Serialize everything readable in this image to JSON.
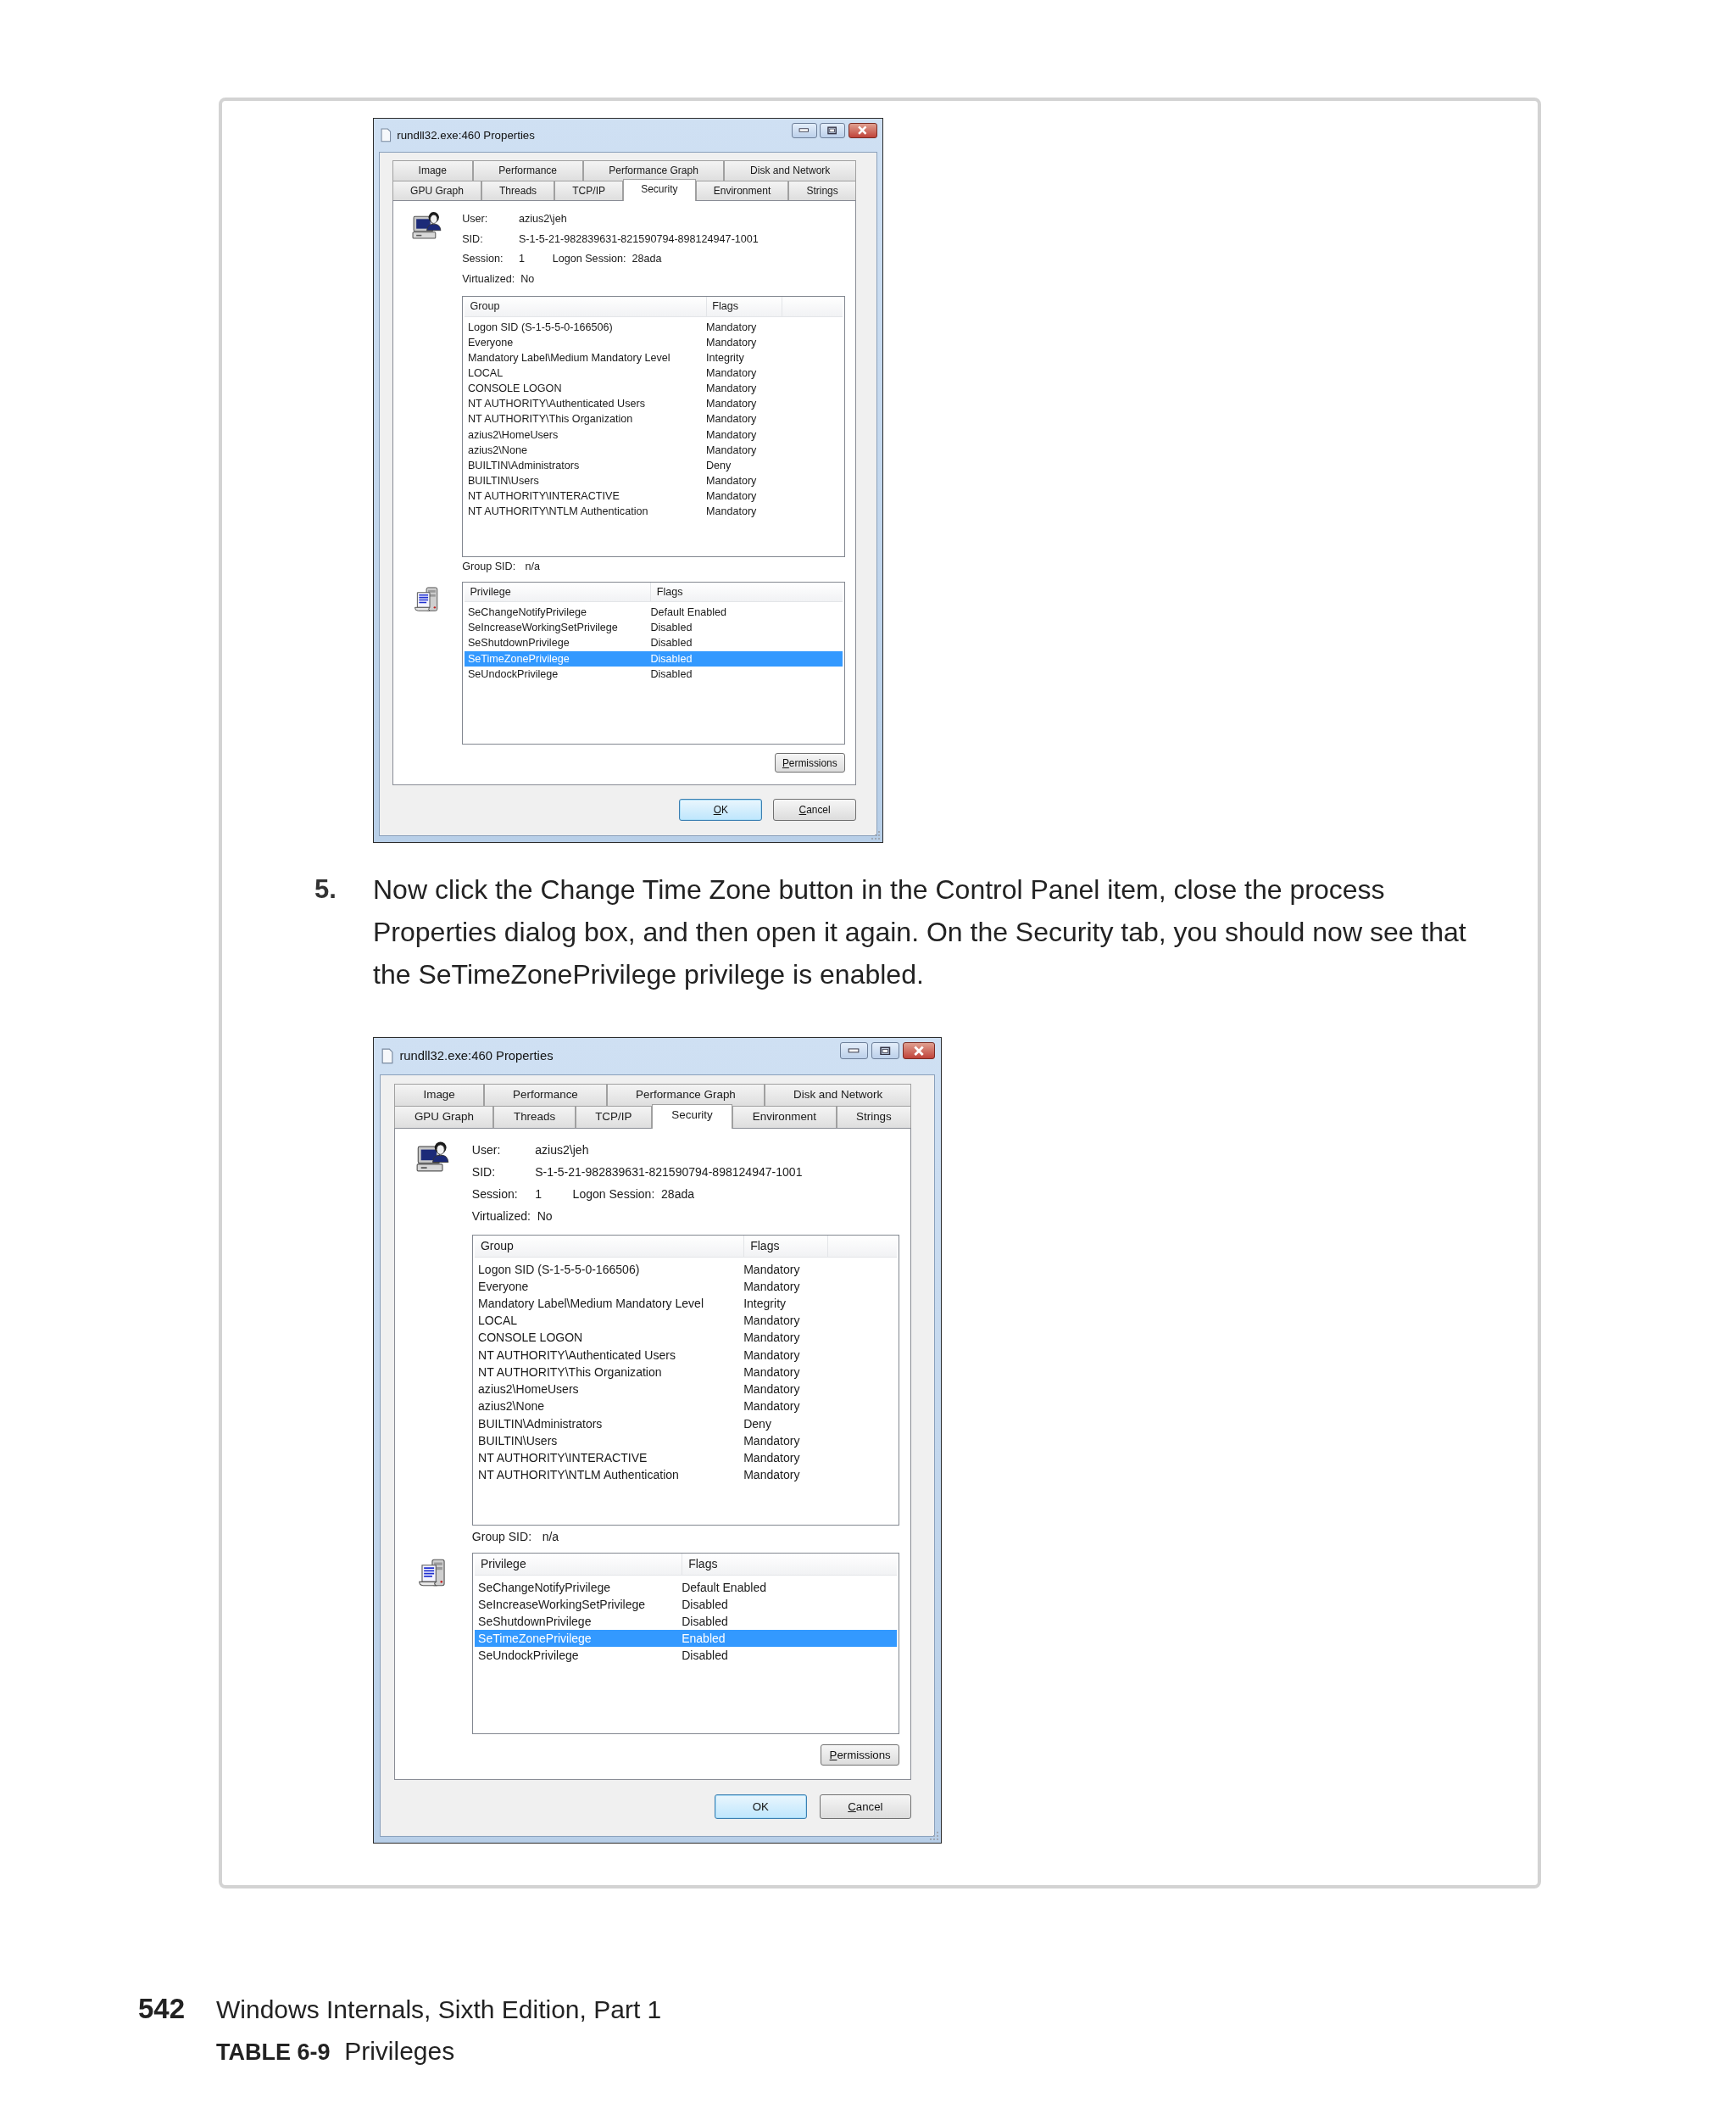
{
  "content": [
    {
      "kind": "dialog",
      "title": "rundll32.exe:460 Properties",
      "tab_rows": [
        [
          {
            "label": "Image",
            "selected": false
          },
          {
            "label": "Performance",
            "selected": false
          },
          {
            "label": "Performance Graph",
            "selected": false
          },
          {
            "label": "Disk and Network",
            "selected": false
          }
        ],
        [
          {
            "label": "GPU Graph",
            "selected": false
          },
          {
            "label": "Threads",
            "selected": false
          },
          {
            "label": "TCP/IP",
            "selected": false
          },
          {
            "label": "Security",
            "selected": true
          },
          {
            "label": "Environment",
            "selected": false
          },
          {
            "label": "Strings",
            "selected": false
          }
        ]
      ],
      "info_lines": [
        [
          {
            "label": "User:",
            "value": "azius2\\jeh"
          }
        ],
        [
          {
            "label": "SID:",
            "value": "S-1-5-21-982839631-821590794-898124947-1001"
          }
        ],
        [
          {
            "label": "Session:",
            "value": "1"
          },
          {
            "label": "Logon Session:",
            "value": "28ada"
          }
        ],
        [
          {
            "label": "Virtualized:",
            "value": "No"
          }
        ]
      ],
      "groups": {
        "columns": [
          "Group",
          "Flags"
        ],
        "rows": [
          {
            "group": "Logon SID (S-1-5-5-0-166506)",
            "flags": "Mandatory"
          },
          {
            "group": "Everyone",
            "flags": "Mandatory"
          },
          {
            "group": "Mandatory Label\\Medium Mandatory Level",
            "flags": "Integrity"
          },
          {
            "group": "LOCAL",
            "flags": "Mandatory"
          },
          {
            "group": "CONSOLE LOGON",
            "flags": "Mandatory"
          },
          {
            "group": "NT AUTHORITY\\Authenticated Users",
            "flags": "Mandatory"
          },
          {
            "group": "NT AUTHORITY\\This Organization",
            "flags": "Mandatory"
          },
          {
            "group": "azius2\\HomeUsers",
            "flags": "Mandatory"
          },
          {
            "group": "azius2\\None",
            "flags": "Mandatory"
          },
          {
            "group": "BUILTIN\\Administrators",
            "flags": "Deny"
          },
          {
            "group": "BUILTIN\\Users",
            "flags": "Mandatory"
          },
          {
            "group": "NT AUTHORITY\\INTERACTIVE",
            "flags": "Mandatory"
          },
          {
            "group": "NT AUTHORITY\\NTLM Authentication",
            "flags": "Mandatory"
          }
        ]
      },
      "group_sid": {
        "label": "Group SID:",
        "value": "n/a"
      },
      "privileges": {
        "columns": [
          "Privilege",
          "Flags"
        ],
        "rows": [
          {
            "privilege": "SeChangeNotifyPrivilege",
            "flags": "Default Enabled",
            "selected": false
          },
          {
            "privilege": "SeIncreaseWorkingSetPrivilege",
            "flags": "Disabled",
            "selected": false
          },
          {
            "privilege": "SeShutdownPrivilege",
            "flags": "Disabled",
            "selected": false
          },
          {
            "privilege": "SeTimeZonePrivilege",
            "flags": "Disabled",
            "selected": true
          },
          {
            "privilege": "SeUndockPrivilege",
            "flags": "Disabled",
            "selected": false
          }
        ]
      },
      "permissions_button": {
        "label": "Permissions",
        "access_key_shown": true
      },
      "buttons": [
        {
          "label": "OK",
          "default": true,
          "access_key_shown": true
        },
        {
          "label": "Cancel",
          "default": false,
          "access_key_shown": true
        }
      ]
    },
    {
      "kind": "step",
      "number": "5.",
      "text": "Now click the Change Time Zone button in the Control Panel item, close the process Properties dialog box, and then open it again. On the Security tab, you should now see that the SeTimeZonePrivilege privilege is enabled."
    },
    {
      "kind": "dialog",
      "title": "rundll32.exe:460 Properties",
      "tab_rows": [
        [
          {
            "label": "Image",
            "selected": false
          },
          {
            "label": "Performance",
            "selected": false
          },
          {
            "label": "Performance Graph",
            "selected": false
          },
          {
            "label": "Disk and Network",
            "selected": false
          }
        ],
        [
          {
            "label": "GPU Graph",
            "selected": false
          },
          {
            "label": "Threads",
            "selected": false
          },
          {
            "label": "TCP/IP",
            "selected": false
          },
          {
            "label": "Security",
            "selected": true
          },
          {
            "label": "Environment",
            "selected": false
          },
          {
            "label": "Strings",
            "selected": false
          }
        ]
      ],
      "info_lines": [
        [
          {
            "label": "User:",
            "value": "azius2\\jeh"
          }
        ],
        [
          {
            "label": "SID:",
            "value": "S-1-5-21-982839631-821590794-898124947-1001"
          }
        ],
        [
          {
            "label": "Session:",
            "value": "1"
          },
          {
            "label": "Logon Session:",
            "value": "28ada"
          }
        ],
        [
          {
            "label": "Virtualized:",
            "value": "No"
          }
        ]
      ],
      "groups": {
        "columns": [
          "Group",
          "Flags"
        ],
        "rows": [
          {
            "group": "Logon SID (S-1-5-5-0-166506)",
            "flags": "Mandatory"
          },
          {
            "group": "Everyone",
            "flags": "Mandatory"
          },
          {
            "group": "Mandatory Label\\Medium Mandatory Level",
            "flags": "Integrity"
          },
          {
            "group": "LOCAL",
            "flags": "Mandatory"
          },
          {
            "group": "CONSOLE LOGON",
            "flags": "Mandatory"
          },
          {
            "group": "NT AUTHORITY\\Authenticated Users",
            "flags": "Mandatory"
          },
          {
            "group": "NT AUTHORITY\\This Organization",
            "flags": "Mandatory"
          },
          {
            "group": "azius2\\HomeUsers",
            "flags": "Mandatory"
          },
          {
            "group": "azius2\\None",
            "flags": "Mandatory"
          },
          {
            "group": "BUILTIN\\Administrators",
            "flags": "Deny"
          },
          {
            "group": "BUILTIN\\Users",
            "flags": "Mandatory"
          },
          {
            "group": "NT AUTHORITY\\INTERACTIVE",
            "flags": "Mandatory"
          },
          {
            "group": "NT AUTHORITY\\NTLM Authentication",
            "flags": "Mandatory"
          }
        ]
      },
      "group_sid": {
        "label": "Group SID:",
        "value": "n/a"
      },
      "privileges": {
        "columns": [
          "Privilege",
          "Flags"
        ],
        "rows": [
          {
            "privilege": "SeChangeNotifyPrivilege",
            "flags": "Default Enabled",
            "selected": false
          },
          {
            "privilege": "SeIncreaseWorkingSetPrivilege",
            "flags": "Disabled",
            "selected": false
          },
          {
            "privilege": "SeShutdownPrivilege",
            "flags": "Disabled",
            "selected": false
          },
          {
            "privilege": "SeTimeZonePrivilege",
            "flags": "Enabled",
            "selected": true
          },
          {
            "privilege": "SeUndockPrivilege",
            "flags": "Disabled",
            "selected": false
          }
        ]
      },
      "permissions_button": {
        "label": "Permissions",
        "access_key_shown": true
      },
      "buttons": [
        {
          "label": "OK",
          "default": true,
          "access_key_shown": false
        },
        {
          "label": "Cancel",
          "default": false,
          "access_key_shown": true
        }
      ]
    }
  ],
  "footer": {
    "page_number": "542",
    "book_title": "Windows Internals, Sixth Edition, Part 1",
    "table_caption": "**TABLE 6-9**  Privileges"
  }
}
